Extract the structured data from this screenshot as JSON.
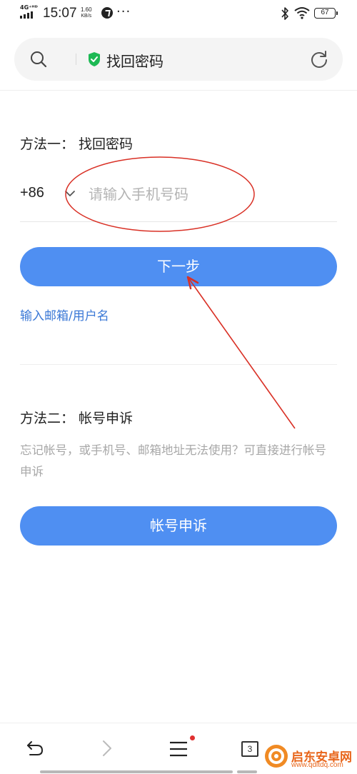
{
  "status_bar": {
    "network": "4G⁺ᴴᴰ",
    "time": "15:07",
    "speed_value": "1.60",
    "speed_unit": "KB/s",
    "more": "···",
    "battery": "67"
  },
  "address_bar": {
    "title": "找回密码"
  },
  "method1": {
    "title": "方法一： 找回密码",
    "country_code": "+86",
    "phone_placeholder": "请输入手机号码",
    "next_button": "下一步",
    "email_link": "输入邮箱/用户名"
  },
  "method2": {
    "title": "方法二： 帐号申诉",
    "description": "忘记帐号，或手机号、邮箱地址无法使用？可直接进行帐号申诉",
    "appeal_button": "帐号申诉"
  },
  "bottom_nav": {
    "tab_count": "3"
  },
  "watermark": {
    "name": "启东安卓网",
    "url": "www.qdltdq.com"
  },
  "colors": {
    "primary_button": "#4f8ff2",
    "link": "#3a78d6",
    "annotation": "#d93025",
    "shield": "#1db954"
  },
  "icons": {
    "search": "search-icon",
    "shield": "shield-check-icon",
    "refresh": "refresh-icon",
    "dropdown": "chevron-down-icon",
    "back": "back-arrow-icon",
    "forward": "forward-arrow-icon",
    "menu": "menu-icon",
    "tabs": "tabs-icon"
  }
}
